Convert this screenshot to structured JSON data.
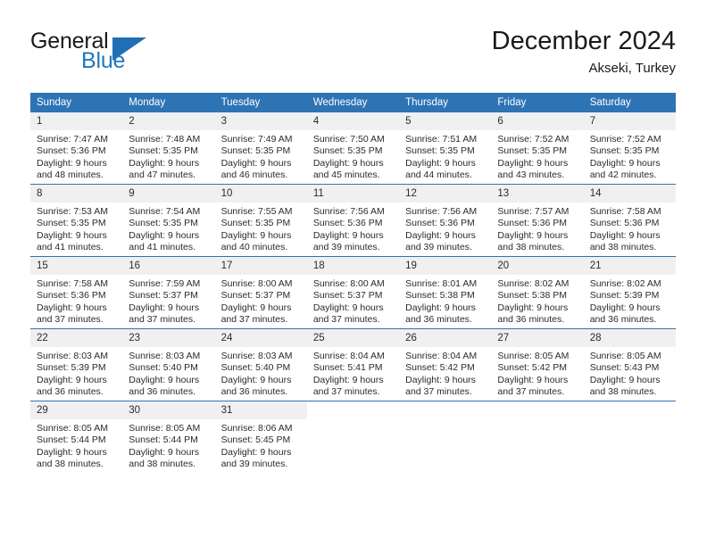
{
  "logo": {
    "word1": "General",
    "word2": "Blue",
    "triangle_icon": "blue-triangle-icon",
    "brand_color": "#1f6fb4"
  },
  "header": {
    "title": "December 2024",
    "subtitle": "Akseki, Turkey"
  },
  "calendar": {
    "header_color": "#2e74b5",
    "daynum_background": "#f0f0f0",
    "weekday_headers": [
      "Sunday",
      "Monday",
      "Tuesday",
      "Wednesday",
      "Thursday",
      "Friday",
      "Saturday"
    ],
    "weeks": [
      [
        {
          "day": "1",
          "sunrise": "Sunrise: 7:47 AM",
          "sunset": "Sunset: 5:36 PM",
          "daylight_line1": "Daylight: 9 hours",
          "daylight_line2": "and 48 minutes."
        },
        {
          "day": "2",
          "sunrise": "Sunrise: 7:48 AM",
          "sunset": "Sunset: 5:35 PM",
          "daylight_line1": "Daylight: 9 hours",
          "daylight_line2": "and 47 minutes."
        },
        {
          "day": "3",
          "sunrise": "Sunrise: 7:49 AM",
          "sunset": "Sunset: 5:35 PM",
          "daylight_line1": "Daylight: 9 hours",
          "daylight_line2": "and 46 minutes."
        },
        {
          "day": "4",
          "sunrise": "Sunrise: 7:50 AM",
          "sunset": "Sunset: 5:35 PM",
          "daylight_line1": "Daylight: 9 hours",
          "daylight_line2": "and 45 minutes."
        },
        {
          "day": "5",
          "sunrise": "Sunrise: 7:51 AM",
          "sunset": "Sunset: 5:35 PM",
          "daylight_line1": "Daylight: 9 hours",
          "daylight_line2": "and 44 minutes."
        },
        {
          "day": "6",
          "sunrise": "Sunrise: 7:52 AM",
          "sunset": "Sunset: 5:35 PM",
          "daylight_line1": "Daylight: 9 hours",
          "daylight_line2": "and 43 minutes."
        },
        {
          "day": "7",
          "sunrise": "Sunrise: 7:52 AM",
          "sunset": "Sunset: 5:35 PM",
          "daylight_line1": "Daylight: 9 hours",
          "daylight_line2": "and 42 minutes."
        }
      ],
      [
        {
          "day": "8",
          "sunrise": "Sunrise: 7:53 AM",
          "sunset": "Sunset: 5:35 PM",
          "daylight_line1": "Daylight: 9 hours",
          "daylight_line2": "and 41 minutes."
        },
        {
          "day": "9",
          "sunrise": "Sunrise: 7:54 AM",
          "sunset": "Sunset: 5:35 PM",
          "daylight_line1": "Daylight: 9 hours",
          "daylight_line2": "and 41 minutes."
        },
        {
          "day": "10",
          "sunrise": "Sunrise: 7:55 AM",
          "sunset": "Sunset: 5:35 PM",
          "daylight_line1": "Daylight: 9 hours",
          "daylight_line2": "and 40 minutes."
        },
        {
          "day": "11",
          "sunrise": "Sunrise: 7:56 AM",
          "sunset": "Sunset: 5:36 PM",
          "daylight_line1": "Daylight: 9 hours",
          "daylight_line2": "and 39 minutes."
        },
        {
          "day": "12",
          "sunrise": "Sunrise: 7:56 AM",
          "sunset": "Sunset: 5:36 PM",
          "daylight_line1": "Daylight: 9 hours",
          "daylight_line2": "and 39 minutes."
        },
        {
          "day": "13",
          "sunrise": "Sunrise: 7:57 AM",
          "sunset": "Sunset: 5:36 PM",
          "daylight_line1": "Daylight: 9 hours",
          "daylight_line2": "and 38 minutes."
        },
        {
          "day": "14",
          "sunrise": "Sunrise: 7:58 AM",
          "sunset": "Sunset: 5:36 PM",
          "daylight_line1": "Daylight: 9 hours",
          "daylight_line2": "and 38 minutes."
        }
      ],
      [
        {
          "day": "15",
          "sunrise": "Sunrise: 7:58 AM",
          "sunset": "Sunset: 5:36 PM",
          "daylight_line1": "Daylight: 9 hours",
          "daylight_line2": "and 37 minutes."
        },
        {
          "day": "16",
          "sunrise": "Sunrise: 7:59 AM",
          "sunset": "Sunset: 5:37 PM",
          "daylight_line1": "Daylight: 9 hours",
          "daylight_line2": "and 37 minutes."
        },
        {
          "day": "17",
          "sunrise": "Sunrise: 8:00 AM",
          "sunset": "Sunset: 5:37 PM",
          "daylight_line1": "Daylight: 9 hours",
          "daylight_line2": "and 37 minutes."
        },
        {
          "day": "18",
          "sunrise": "Sunrise: 8:00 AM",
          "sunset": "Sunset: 5:37 PM",
          "daylight_line1": "Daylight: 9 hours",
          "daylight_line2": "and 37 minutes."
        },
        {
          "day": "19",
          "sunrise": "Sunrise: 8:01 AM",
          "sunset": "Sunset: 5:38 PM",
          "daylight_line1": "Daylight: 9 hours",
          "daylight_line2": "and 36 minutes."
        },
        {
          "day": "20",
          "sunrise": "Sunrise: 8:02 AM",
          "sunset": "Sunset: 5:38 PM",
          "daylight_line1": "Daylight: 9 hours",
          "daylight_line2": "and 36 minutes."
        },
        {
          "day": "21",
          "sunrise": "Sunrise: 8:02 AM",
          "sunset": "Sunset: 5:39 PM",
          "daylight_line1": "Daylight: 9 hours",
          "daylight_line2": "and 36 minutes."
        }
      ],
      [
        {
          "day": "22",
          "sunrise": "Sunrise: 8:03 AM",
          "sunset": "Sunset: 5:39 PM",
          "daylight_line1": "Daylight: 9 hours",
          "daylight_line2": "and 36 minutes."
        },
        {
          "day": "23",
          "sunrise": "Sunrise: 8:03 AM",
          "sunset": "Sunset: 5:40 PM",
          "daylight_line1": "Daylight: 9 hours",
          "daylight_line2": "and 36 minutes."
        },
        {
          "day": "24",
          "sunrise": "Sunrise: 8:03 AM",
          "sunset": "Sunset: 5:40 PM",
          "daylight_line1": "Daylight: 9 hours",
          "daylight_line2": "and 36 minutes."
        },
        {
          "day": "25",
          "sunrise": "Sunrise: 8:04 AM",
          "sunset": "Sunset: 5:41 PM",
          "daylight_line1": "Daylight: 9 hours",
          "daylight_line2": "and 37 minutes."
        },
        {
          "day": "26",
          "sunrise": "Sunrise: 8:04 AM",
          "sunset": "Sunset: 5:42 PM",
          "daylight_line1": "Daylight: 9 hours",
          "daylight_line2": "and 37 minutes."
        },
        {
          "day": "27",
          "sunrise": "Sunrise: 8:05 AM",
          "sunset": "Sunset: 5:42 PM",
          "daylight_line1": "Daylight: 9 hours",
          "daylight_line2": "and 37 minutes."
        },
        {
          "day": "28",
          "sunrise": "Sunrise: 8:05 AM",
          "sunset": "Sunset: 5:43 PM",
          "daylight_line1": "Daylight: 9 hours",
          "daylight_line2": "and 38 minutes."
        }
      ],
      [
        {
          "day": "29",
          "sunrise": "Sunrise: 8:05 AM",
          "sunset": "Sunset: 5:44 PM",
          "daylight_line1": "Daylight: 9 hours",
          "daylight_line2": "and 38 minutes."
        },
        {
          "day": "30",
          "sunrise": "Sunrise: 8:05 AM",
          "sunset": "Sunset: 5:44 PM",
          "daylight_line1": "Daylight: 9 hours",
          "daylight_line2": "and 38 minutes."
        },
        {
          "day": "31",
          "sunrise": "Sunrise: 8:06 AM",
          "sunset": "Sunset: 5:45 PM",
          "daylight_line1": "Daylight: 9 hours",
          "daylight_line2": "and 39 minutes."
        },
        {
          "day": "",
          "sunrise": "",
          "sunset": "",
          "daylight_line1": "",
          "daylight_line2": ""
        },
        {
          "day": "",
          "sunrise": "",
          "sunset": "",
          "daylight_line1": "",
          "daylight_line2": ""
        },
        {
          "day": "",
          "sunrise": "",
          "sunset": "",
          "daylight_line1": "",
          "daylight_line2": ""
        },
        {
          "day": "",
          "sunrise": "",
          "sunset": "",
          "daylight_line1": "",
          "daylight_line2": ""
        }
      ]
    ]
  }
}
